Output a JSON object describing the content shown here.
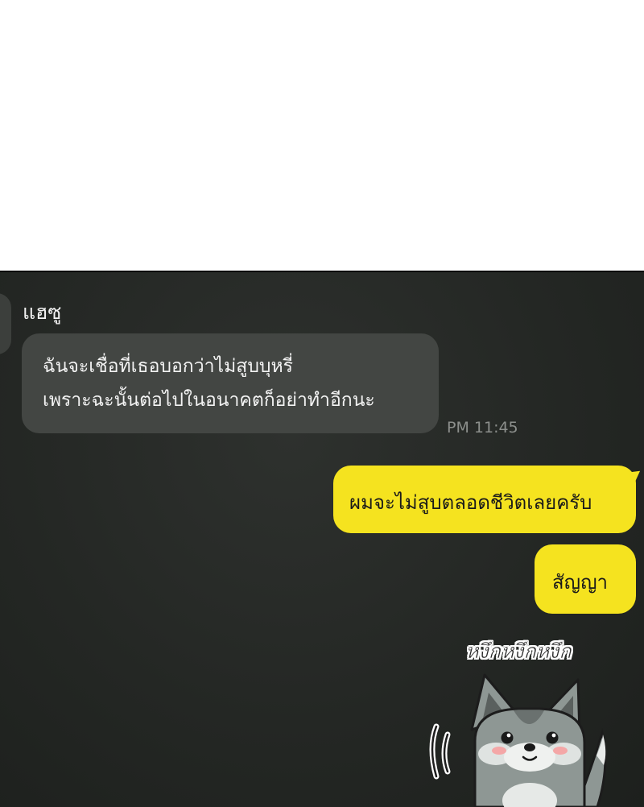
{
  "chat": {
    "sender_name": "แฮซู",
    "incoming_message": {
      "lines": [
        "ฉันจะเชื่อที่เธอบอกว่าไม่สูบบุหรี่",
        "เพราะฉะนั้นต่อไปในอนาคตก็อย่าทำอีกนะ"
      ],
      "time": "PM 11:45"
    },
    "outgoing_messages": [
      "ผมจะไม่สูบตลอดชีวิตเลยครับ",
      "สัญญา"
    ],
    "sticker": {
      "icon": "wolf-puppy-sticker-icon",
      "caption": "หงึกหงึกหงึก"
    }
  },
  "colors": {
    "chat_background": "#262926",
    "incoming_bubble": "#434643",
    "outgoing_bubble": "#f5e31f",
    "timestamp": "#8c8f8c"
  }
}
